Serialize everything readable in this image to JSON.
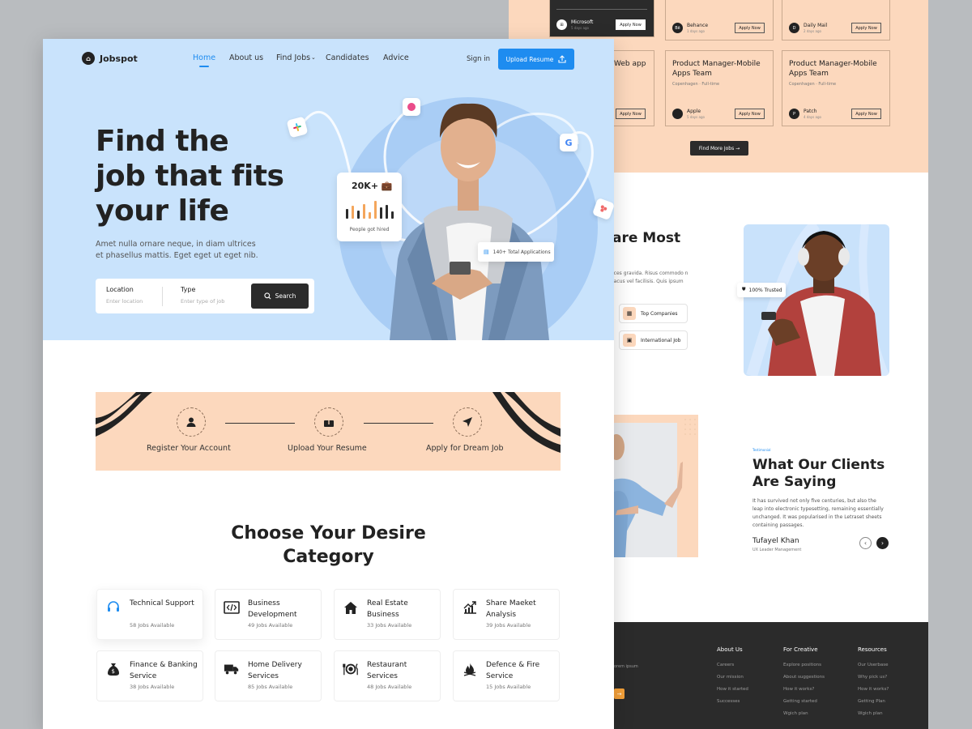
{
  "back_page": {
    "jobs": [
      {
        "title": "",
        "company": "Microsoft",
        "ago": "5 days ago",
        "apply": "Apply Now",
        "dark": true
      },
      {
        "title": "",
        "company": "Behance",
        "ago": "1 days ago",
        "apply": "Apply Now"
      },
      {
        "title": "",
        "company": "Daily Mail",
        "ago": "2 days ago",
        "apply": "Apply Now"
      },
      {
        "title": "Web app",
        "company": "",
        "ago": "",
        "apply": "Apply Now"
      },
      {
        "title": "Product Manager-Mobile Apps Team",
        "meta": "Copenhagen · Full-time",
        "company": "Apple",
        "ago": "5 days ago",
        "apply": "Apply Now"
      },
      {
        "title": "Product Manager-Mobile Apps Team",
        "meta": "Copenhagen · Full-time",
        "company": "Patch",
        "ago": "4 days ago",
        "apply": "Apply Now"
      }
    ],
    "find_more": "Find More Jobs",
    "why_title": "are Most",
    "why_text": "ices gravida. Risus commodo n lacus vel facilisis. Quis ipsum",
    "pills": [
      "Top Companies",
      "International Job"
    ],
    "trusted": "100% Trusted",
    "testimonial": {
      "tag": "Testimonial",
      "title": "What Our Clients Are Saying",
      "body": "It has survived not only five centuries, but also the leap into electronic typesetting, remaining essentially unchanged. It was popularised in the Letraset sheets containing passages.",
      "name": "Tufayel Khan",
      "role": "UX Leader Management"
    },
    "footer": {
      "lorem": "orem ipsum",
      "cols": [
        {
          "heading": "About Us",
          "links": [
            "Careers",
            "Our mission",
            "How it started",
            "Successes"
          ]
        },
        {
          "heading": "For Creative",
          "links": [
            "Explore positions",
            "About suggestions",
            "How it works?",
            "Getting started",
            "Wgich plan"
          ]
        },
        {
          "heading": "Resources",
          "links": [
            "Our Userbase",
            "Why pick us?",
            "How it works?",
            "Getting Plan",
            "Wgich plan"
          ]
        }
      ]
    }
  },
  "front_page": {
    "brand": "Jobspot",
    "nav": [
      "Home",
      "About us",
      "Find Jobs",
      "Candidates",
      "Advice"
    ],
    "signin": "Sign in",
    "upload_btn": "Upload Resume",
    "headline": [
      "Find the",
      "job that fits",
      "your life"
    ],
    "subtext": "Amet nulla ornare neque, in diam ultrices et phasellus mattis. Eget eget ut eget nib.",
    "search": {
      "location_label": "Location",
      "location_placeholder": "Enter location",
      "type_label": "Type",
      "type_placeholder": "Enter type of job",
      "button": "Search"
    },
    "hero_stat": {
      "value": "20K+",
      "caption": "People got hired"
    },
    "applications": "140+ Total Applications",
    "steps": [
      "Register Your Account",
      "Upload Your Resume",
      "Apply for Dream Job"
    ],
    "category_title": "Choose Your Desire Category",
    "categories": [
      {
        "name": "Technical Support",
        "count": "58 Jobs Available",
        "icon": "headset-icon"
      },
      {
        "name": "Business Development",
        "count": "49 Jobs Available",
        "icon": "code-icon"
      },
      {
        "name": "Real Estate Business",
        "count": "33 Jobs Available",
        "icon": "house-icon"
      },
      {
        "name": "Share Maeket Analysis",
        "count": "39 Jobs Available",
        "icon": "chart-icon"
      },
      {
        "name": "Finance & Banking Service",
        "count": "38 Jobs Available",
        "icon": "money-bag-icon"
      },
      {
        "name": "Home Delivery Services",
        "count": "85 Jobs Available",
        "icon": "truck-icon"
      },
      {
        "name": "Restaurant Services",
        "count": "48 Jobs Available",
        "icon": "dining-icon"
      },
      {
        "name": "Defence & Fire Service",
        "count": "15 Jobs Available",
        "icon": "fire-icon"
      }
    ],
    "colors": {
      "accent": "#1e8cf0",
      "hero_bg": "#c9e3fc",
      "peach": "#fcd8bd",
      "dark": "#2b2b2b"
    }
  }
}
